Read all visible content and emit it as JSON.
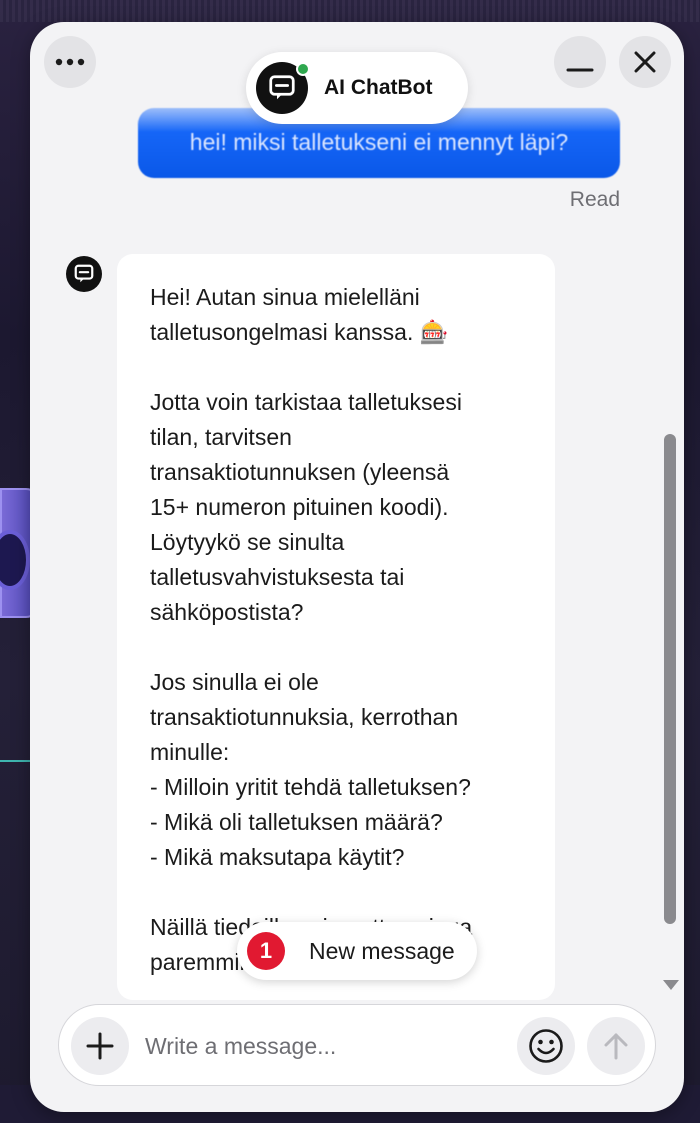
{
  "header": {
    "title": "AI ChatBot",
    "status": "online"
  },
  "messages": {
    "user": {
      "text": "hei! miksi talletukseni ei mennyt läpi?",
      "status": "Read"
    },
    "bot": {
      "lines_1": [
        "Hei! Autan sinua mielelläni",
        "talletusongelmasi kanssa. 🎰"
      ],
      "lines_2": [
        "Jotta voin tarkistaa talletuksesi",
        "tilan, tarvitsen",
        "transaktiotunnuksen (yleensä",
        "15+ numeron pituinen koodi).",
        "Löytyykö se sinulta",
        "talletusvahvistuksesta tai",
        "sähköpostista?"
      ],
      "lines_3": [
        "Jos sinulla ei ole",
        "transaktiotunnuksia, kerrothan",
        "minulle:",
        "- Milloin yritit tehdä talletuksen?",
        "- Mikä oli talletuksen määrä?",
        "- Mikä maksutapa käytit?"
      ],
      "lines_4": [
        "Näillä tiedoilla voin auttaa sinua",
        "paremmin."
      ]
    }
  },
  "new_message": {
    "count": "1",
    "label": "New message"
  },
  "composer": {
    "placeholder": "Write a message..."
  },
  "colors": {
    "accent": "#0a58e8",
    "badge": "#e11931",
    "online": "#2fa84f"
  },
  "icons": [
    "more-icon",
    "minimize-icon",
    "close-icon",
    "chat-bubble-icon",
    "plus-icon",
    "emoji-icon",
    "arrow-up-icon"
  ]
}
